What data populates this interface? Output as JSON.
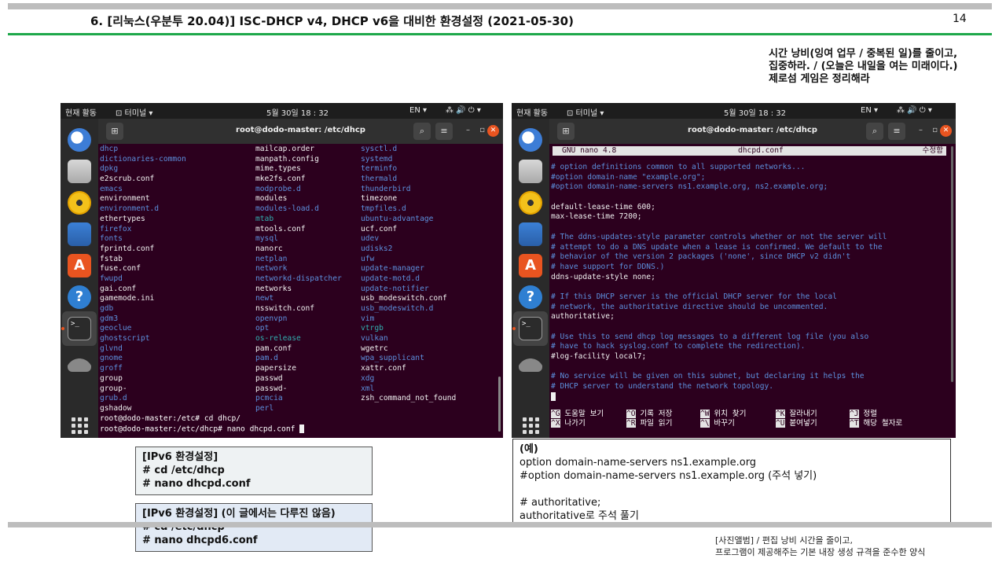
{
  "slide": {
    "title": "6. [리눅스(우분투 20.04)] ISC-DHCP v4, DHCP v6을 대비한 환경설정 (2021-05-30)",
    "page_number": "14",
    "quote": [
      "시간 낭비(잉여 업무 / 중복된 일)를 줄이고,",
      "집중하라. / (오늘은 내일을 여는 미래이다.)",
      "제로섬 게임은 정리해라"
    ],
    "caption": [
      "[사진앨범] / 편집 낭비 시간을 줄이고,",
      "프로그램이 제공해주는 기본 내장 생성 규격을 준수한 양식"
    ]
  },
  "desktop": {
    "activities": "현재 활동",
    "app_menu": "⊡ 터미널 ▾",
    "clock": "5월 30일 18 : 32",
    "lang": "EN ▾",
    "tray": "⁂ 🔊 ⏻ ▾",
    "dock_icons": [
      "thunderbird-icon",
      "files-icon",
      "rhythmbox-icon",
      "writer-icon",
      "software-center-icon",
      "help-icon",
      "terminal-icon",
      "disc-icon",
      "apps-grid-icon"
    ]
  },
  "terminal_left": {
    "window_title": "root@dodo-master: /etc/dhcp",
    "columns": [
      [
        {
          "t": "dhcp",
          "c": "blue"
        },
        {
          "t": "dictionaries-common",
          "c": "blue"
        },
        {
          "t": "dpkg",
          "c": "blue"
        },
        {
          "t": "e2scrub.conf",
          "c": "wht"
        },
        {
          "t": "emacs",
          "c": "blue"
        },
        {
          "t": "environment",
          "c": "wht"
        },
        {
          "t": "environment.d",
          "c": "blue"
        },
        {
          "t": "ethertypes",
          "c": "wht"
        },
        {
          "t": "firefox",
          "c": "blue"
        },
        {
          "t": "fonts",
          "c": "blue"
        },
        {
          "t": "fprintd.conf",
          "c": "wht"
        },
        {
          "t": "fstab",
          "c": "wht"
        },
        {
          "t": "fuse.conf",
          "c": "wht"
        },
        {
          "t": "fwupd",
          "c": "blue"
        },
        {
          "t": "gai.conf",
          "c": "wht"
        },
        {
          "t": "gamemode.ini",
          "c": "wht"
        },
        {
          "t": "gdb",
          "c": "blue"
        },
        {
          "t": "gdm3",
          "c": "blue"
        },
        {
          "t": "geoclue",
          "c": "blue"
        },
        {
          "t": "ghostscript",
          "c": "blue"
        },
        {
          "t": "glvnd",
          "c": "blue"
        },
        {
          "t": "gnome",
          "c": "blue"
        },
        {
          "t": "groff",
          "c": "blue"
        },
        {
          "t": "group",
          "c": "wht"
        },
        {
          "t": "group-",
          "c": "wht"
        },
        {
          "t": "grub.d",
          "c": "blue"
        },
        {
          "t": "gshadow",
          "c": "wht"
        }
      ],
      [
        {
          "t": "mailcap.order",
          "c": "wht"
        },
        {
          "t": "manpath.config",
          "c": "wht"
        },
        {
          "t": "mime.types",
          "c": "wht"
        },
        {
          "t": "mke2fs.conf",
          "c": "wht"
        },
        {
          "t": "modprobe.d",
          "c": "blue"
        },
        {
          "t": "modules",
          "c": "wht"
        },
        {
          "t": "modules-load.d",
          "c": "blue"
        },
        {
          "t": "mtab",
          "c": "cyan"
        },
        {
          "t": "mtools.conf",
          "c": "wht"
        },
        {
          "t": "mysql",
          "c": "blue"
        },
        {
          "t": "nanorc",
          "c": "wht"
        },
        {
          "t": "netplan",
          "c": "blue"
        },
        {
          "t": "network",
          "c": "blue"
        },
        {
          "t": "networkd-dispatcher",
          "c": "blue"
        },
        {
          "t": "networks",
          "c": "wht"
        },
        {
          "t": "newt",
          "c": "blue"
        },
        {
          "t": "nsswitch.conf",
          "c": "wht"
        },
        {
          "t": "openvpn",
          "c": "blue"
        },
        {
          "t": "opt",
          "c": "blue"
        },
        {
          "t": "os-release",
          "c": "cyan"
        },
        {
          "t": "pam.conf",
          "c": "wht"
        },
        {
          "t": "pam.d",
          "c": "blue"
        },
        {
          "t": "papersize",
          "c": "wht"
        },
        {
          "t": "passwd",
          "c": "wht"
        },
        {
          "t": "passwd-",
          "c": "wht"
        },
        {
          "t": "pcmcia",
          "c": "blue"
        },
        {
          "t": "perl",
          "c": "blue"
        }
      ],
      [
        {
          "t": "sysctl.d",
          "c": "blue"
        },
        {
          "t": "systemd",
          "c": "blue"
        },
        {
          "t": "terminfo",
          "c": "blue"
        },
        {
          "t": "thermald",
          "c": "blue"
        },
        {
          "t": "thunderbird",
          "c": "blue"
        },
        {
          "t": "timezone",
          "c": "wht"
        },
        {
          "t": "tmpfiles.d",
          "c": "blue"
        },
        {
          "t": "ubuntu-advantage",
          "c": "blue"
        },
        {
          "t": "ucf.conf",
          "c": "wht"
        },
        {
          "t": "udev",
          "c": "blue"
        },
        {
          "t": "udisks2",
          "c": "blue"
        },
        {
          "t": "ufw",
          "c": "blue"
        },
        {
          "t": "update-manager",
          "c": "blue"
        },
        {
          "t": "update-motd.d",
          "c": "blue"
        },
        {
          "t": "update-notifier",
          "c": "blue"
        },
        {
          "t": "usb_modeswitch.conf",
          "c": "wht"
        },
        {
          "t": "usb_modeswitch.d",
          "c": "blue"
        },
        {
          "t": "vim",
          "c": "blue"
        },
        {
          "t": "vtrgb",
          "c": "cyan"
        },
        {
          "t": "vulkan",
          "c": "blue"
        },
        {
          "t": "wgetrc",
          "c": "wht"
        },
        {
          "t": "wpa_supplicant",
          "c": "blue"
        },
        {
          "t": "xattr.conf",
          "c": "wht"
        },
        {
          "t": "xdg",
          "c": "blue"
        },
        {
          "t": "xml",
          "c": "blue"
        },
        {
          "t": "zsh_command_not_found",
          "c": "wht"
        }
      ]
    ],
    "prompt_lines": [
      "root@dodo-master:/etc# cd dhcp/",
      "root@dodo-master:/etc/dhcp# nano dhcpd.conf "
    ]
  },
  "terminal_right": {
    "window_title": "root@dodo-master: /etc/dhcp",
    "nano_version": "GNU nano 4.8",
    "nano_file": "dhcpd.conf",
    "nano_status": "수정함",
    "lines": [
      {
        "t": "# option definitions common to all supported networks...",
        "c": "blue"
      },
      {
        "t": "#option domain-name \"example.org\";",
        "c": "blue"
      },
      {
        "t": "#option domain-name-servers ns1.example.org, ns2.example.org;",
        "c": "blue"
      },
      {
        "t": "",
        "c": "wht"
      },
      {
        "t": "default-lease-time 600;",
        "c": "wht"
      },
      {
        "t": "max-lease-time 7200;",
        "c": "wht"
      },
      {
        "t": "",
        "c": "wht"
      },
      {
        "t": "# The ddns-updates-style parameter controls whether or not the server will",
        "c": "blue"
      },
      {
        "t": "# attempt to do a DNS update when a lease is confirmed. We default to the",
        "c": "blue"
      },
      {
        "t": "# behavior of the version 2 packages ('none', since DHCP v2 didn't",
        "c": "blue"
      },
      {
        "t": "# have support for DDNS.)",
        "c": "blue"
      },
      {
        "t": "ddns-update-style none;",
        "c": "wht"
      },
      {
        "t": "",
        "c": "wht"
      },
      {
        "t": "# If this DHCP server is the official DHCP server for the local",
        "c": "blue"
      },
      {
        "t": "# network, the authoritative directive should be uncommented.",
        "c": "blue"
      },
      {
        "t": "authoritative;",
        "c": "wht"
      },
      {
        "t": "",
        "c": "wht"
      },
      {
        "t": "# Use this to send dhcp log messages to a different log file (you also",
        "c": "blue"
      },
      {
        "t": "# have to hack syslog.conf to complete the redirection).",
        "c": "blue"
      },
      {
        "t": "#log-facility local7;",
        "c": "wht"
      },
      {
        "t": "",
        "c": "wht"
      },
      {
        "t": "# No service will be given on this subnet, but declaring it helps the",
        "c": "blue"
      },
      {
        "t": "# DHCP server to understand the network topology.",
        "c": "blue"
      }
    ],
    "shortcuts": [
      {
        "k": "^G",
        "l": "도움말 보기"
      },
      {
        "k": "^O",
        "l": "기록 저장"
      },
      {
        "k": "^W",
        "l": "위치 찾기"
      },
      {
        "k": "^K",
        "l": "잘라내기"
      },
      {
        "k": "^J",
        "l": "정렬"
      },
      {
        "k": "^X",
        "l": "나가기"
      },
      {
        "k": "^R",
        "l": "파일 읽기"
      },
      {
        "k": "^\\",
        "l": "바꾸기"
      },
      {
        "k": "^U",
        "l": "붙여넣기"
      },
      {
        "k": "^T",
        "l": "해당 철자로"
      }
    ]
  },
  "notes": {
    "ipv4": [
      "[IPv6 환경설정]",
      "# cd /etc/dhcp",
      "# nano dhcpd.conf"
    ],
    "ipv6": [
      "[IPv6 환경설정] (이 글에서는 다루진 않음)",
      "# cd /etc/dhcp",
      "# nano dhcpd6.conf"
    ],
    "example": [
      "(예)",
      "option domain-name-servers ns1.example.org",
      "#option domain-name-servers ns1.example.org (주석 넣기)",
      "",
      "# authoritative;",
      "authoritative로 주석 풀기"
    ]
  },
  "colors": {
    "terminal_bg": "#2c001e",
    "accent_green": "#1ea84a",
    "ubuntu_orange": "#e95420",
    "dir_blue": "#5c8fdd",
    "link_cyan": "#31aeb0"
  }
}
